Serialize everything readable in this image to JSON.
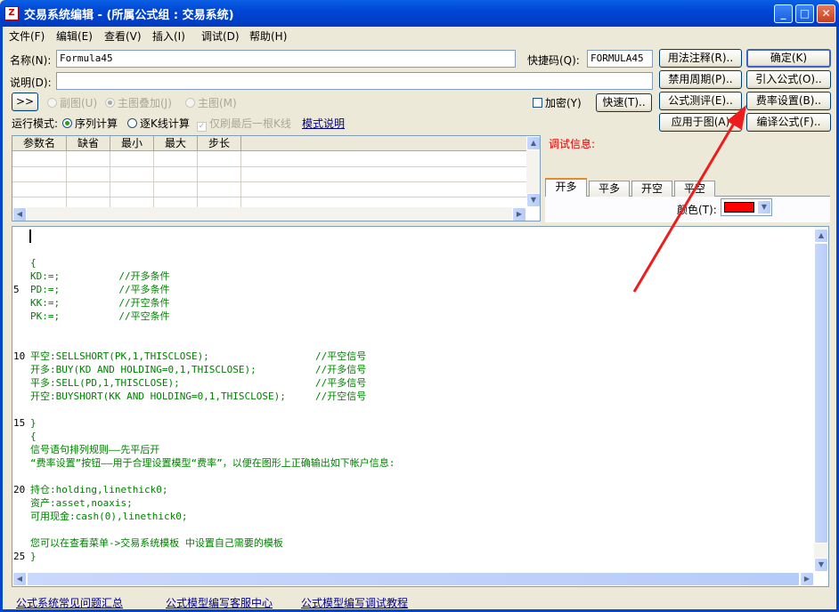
{
  "window": {
    "title": "交易系统编辑 - (所属公式组 : 交易系统)",
    "icon_char": "Z"
  },
  "menu": [
    "文件(F)",
    "编辑(E)",
    "查看(V)",
    "插入(I)",
    "调试(D)",
    "帮助(H)"
  ],
  "fields": {
    "name_label": "名称(N):",
    "name_value": "Formula45",
    "shortcut_label": "快捷码(Q):",
    "shortcut_value": "FORMULA45",
    "desc_label": "说明(D):",
    "desc_value": ""
  },
  "buttons": {
    "usage_note": "用法注释(R)..",
    "confirm": "确定(K)",
    "disable_period": "禁用周期(P)..",
    "import_formula": "引入公式(O)..",
    "formula_test": "公式测评(E)..",
    "fee_settings": "费率设置(B)..",
    "apply_chart": "应用于图(A)",
    "compile": "编译公式(F)..",
    "quick": "快速(T)..",
    "expand": ">>"
  },
  "options": {
    "sub_chart": "副图(U)",
    "main_overlay": "主图叠加(J)",
    "main_chart": "主图(M)",
    "encrypt": "加密(Y)",
    "run_mode_label": "运行模式:",
    "sequential": "序列计算",
    "per_bar": "逐K线计算",
    "refresh_last": "仅刷最后一根K线",
    "mode_help": "模式说明"
  },
  "param_table": {
    "headers": [
      "参数名",
      "缺省",
      "最小",
      "最大",
      "步长"
    ]
  },
  "debug": {
    "label": "调试信息:"
  },
  "signal_tabs": [
    "开多",
    "平多",
    "开空",
    "平空"
  ],
  "color": {
    "label": "颜色(T):",
    "value": "#ff0000"
  },
  "editor": {
    "lines": [
      {
        "n": "",
        "t": ""
      },
      {
        "n": "",
        "t": ""
      },
      {
        "n": "",
        "t": "{"
      },
      {
        "n": "",
        "t": "KD:=;          //开多条件"
      },
      {
        "n": "5",
        "t": "PD:=;          //平多条件"
      },
      {
        "n": "",
        "t": "KK:=;          //开空条件"
      },
      {
        "n": "",
        "t": "PK:=;          //平空条件"
      },
      {
        "n": "",
        "t": ""
      },
      {
        "n": "",
        "t": ""
      },
      {
        "n": "10",
        "t": "平空:SELLSHORT(PK,1,THISCLOSE);                  //平空信号"
      },
      {
        "n": "",
        "t": "开多:BUY(KD AND HOLDING=0,1,THISCLOSE);          //开多信号"
      },
      {
        "n": "",
        "t": "平多:SELL(PD,1,THISCLOSE);                       //平多信号"
      },
      {
        "n": "",
        "t": "开空:BUYSHORT(KK AND HOLDING=0,1,THISCLOSE);     //开空信号"
      },
      {
        "n": "",
        "t": ""
      },
      {
        "n": "15",
        "t": "}"
      },
      {
        "n": "",
        "t": "{"
      },
      {
        "n": "",
        "t": "信号语句排列规则——先平后开"
      },
      {
        "n": "",
        "t": "“费率设置”按钮——用于合理设置模型“费率”，以便在图形上正确输出如下帐户信息:"
      },
      {
        "n": "",
        "t": ""
      },
      {
        "n": "20",
        "t": "持仓:holding,linethick0;"
      },
      {
        "n": "",
        "t": "资产:asset,noaxis;"
      },
      {
        "n": "",
        "t": "可用现金:cash(0),linethick0;"
      },
      {
        "n": "",
        "t": ""
      },
      {
        "n": "",
        "t": "您可以在查看菜单->交易系统模板 中设置自己需要的模板"
      },
      {
        "n": "25",
        "t": "}"
      }
    ]
  },
  "footer_links": [
    "公式系统常见问题汇总",
    "公式模型编写客服中心",
    "公式模型编写调试教程"
  ]
}
